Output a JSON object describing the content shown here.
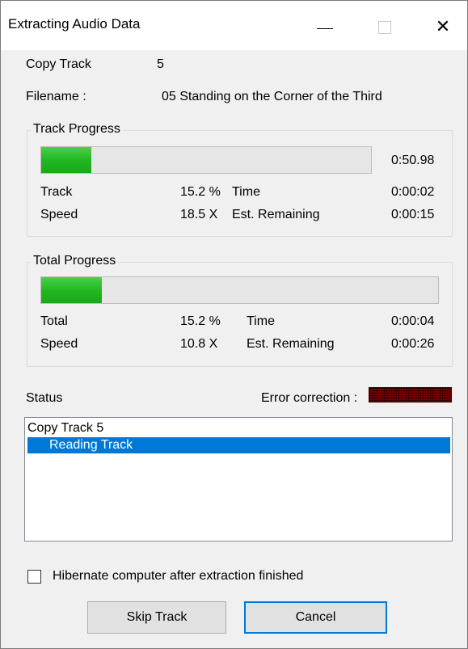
{
  "window": {
    "title": "Extracting Audio Data",
    "controls": {
      "minimize_icon": "minimize-icon",
      "maximize_icon": "maximize-icon",
      "close_glyph": "✕"
    }
  },
  "copy_track": {
    "label": "Copy Track",
    "value": "5"
  },
  "filename": {
    "label": "Filename :",
    "value": "05 Standing on the Corner of the Third"
  },
  "track_progress": {
    "title": "Track Progress",
    "progress": 0.152,
    "length": "0:50.98",
    "rows": [
      {
        "label": "Track",
        "value": "15.2 %",
        "label2": "Time",
        "value2": "0:00:02"
      },
      {
        "label": "Speed",
        "value": "18.5 X",
        "label2": "Est. Remaining",
        "value2": "0:00:15"
      }
    ]
  },
  "total_progress": {
    "title": "Total Progress",
    "progress": 0.152,
    "rows": [
      {
        "label": "Total",
        "value": "15.2 %",
        "label2": "Time",
        "value2": "0:00:04"
      },
      {
        "label": "Speed",
        "value": "10.8 X",
        "label2": "Est. Remaining",
        "value2": "0:00:26"
      }
    ]
  },
  "status": {
    "label": "Status",
    "error_correction_label": "Error correction :",
    "error_indicator_color": "#7a0000",
    "items": [
      {
        "text": "Copy Track  5",
        "selected": false
      },
      {
        "text": "Reading Track",
        "selected": true
      }
    ]
  },
  "hibernate": {
    "label": "Hibernate computer after extraction finished",
    "checked": false
  },
  "buttons": {
    "skip": "Skip Track",
    "cancel": "Cancel"
  },
  "colors": {
    "progress": "#22b822",
    "selection": "#0078d7",
    "background": "#f0f0f0"
  }
}
